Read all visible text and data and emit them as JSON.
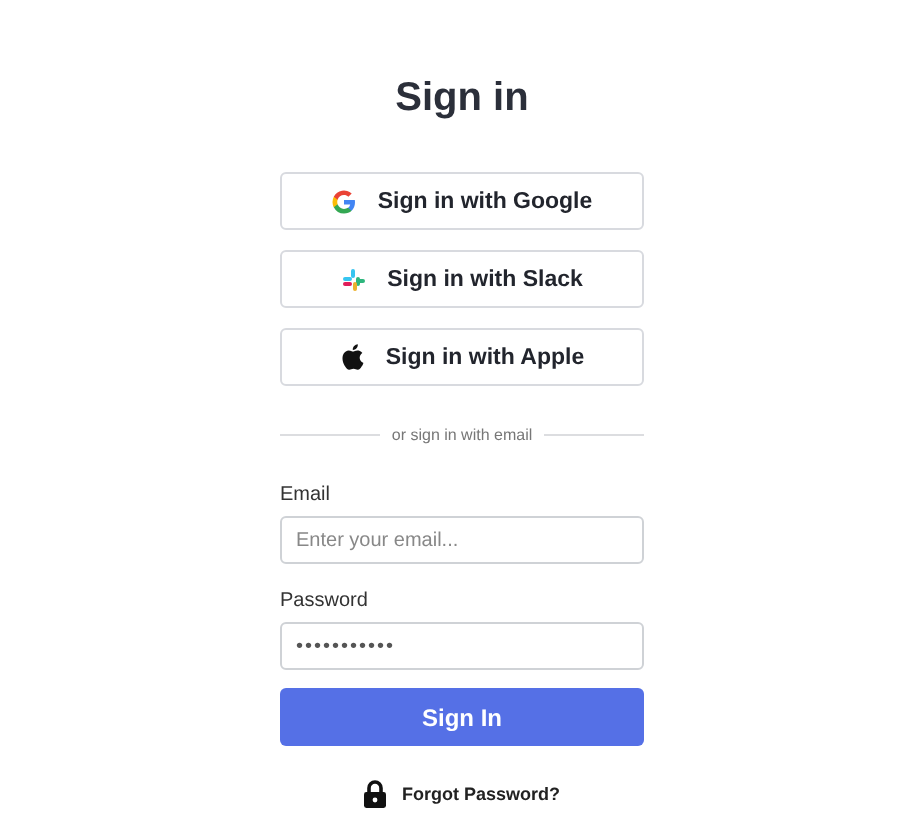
{
  "title": "Sign in",
  "providers": [
    {
      "kind": "google",
      "label": "Sign in with Google"
    },
    {
      "kind": "slack",
      "label": "Sign in with Slack"
    },
    {
      "kind": "apple",
      "label": "Sign in with Apple"
    }
  ],
  "divider": "or sign in with email",
  "email": {
    "label": "Email",
    "placeholder": "Enter your email..."
  },
  "password": {
    "label": "Password",
    "value": "•••••••••••"
  },
  "submit": "Sign In",
  "forgot": "Forgot Password?"
}
